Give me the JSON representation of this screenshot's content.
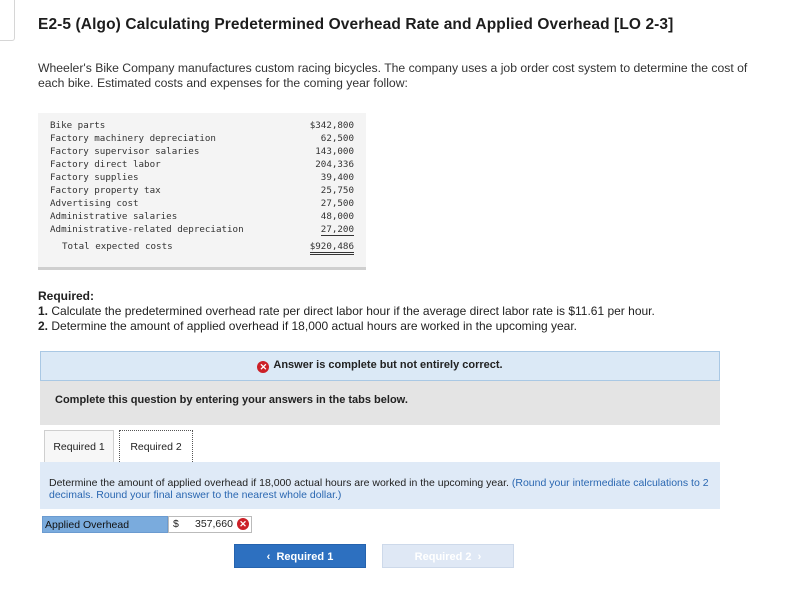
{
  "title": "E2-5 (Algo) Calculating Predetermined Overhead Rate and Applied Overhead [LO 2-3]",
  "intro": "Wheeler's Bike Company manufactures custom racing bicycles. The company uses a job order cost system to determine the cost of each bike. Estimated costs and expenses for the coming year follow:",
  "costs": [
    {
      "label": "Bike parts",
      "amount": "$342,800"
    },
    {
      "label": "Factory machinery depreciation",
      "amount": "62,500"
    },
    {
      "label": "Factory supervisor salaries",
      "amount": "143,000"
    },
    {
      "label": "Factory direct labor",
      "amount": "204,336"
    },
    {
      "label": "Factory supplies",
      "amount": "39,400"
    },
    {
      "label": "Factory property tax",
      "amount": "25,750"
    },
    {
      "label": "Advertising cost",
      "amount": "27,500"
    },
    {
      "label": "Administrative salaries",
      "amount": "48,000"
    },
    {
      "label": "Administrative-related depreciation",
      "amount": "27,200"
    }
  ],
  "total": {
    "label": "Total expected costs",
    "amount": "$920,486"
  },
  "required": {
    "heading": "Required:",
    "item1_num": "1.",
    "item1": "Calculate the predetermined overhead rate per direct labor hour if the average direct labor rate is $11.61 per hour.",
    "item2_num": "2.",
    "item2": "Determine the amount of applied overhead if 18,000 actual hours are worked in the upcoming year."
  },
  "banner": {
    "text": "Answer is complete but not entirely correct.",
    "icon": "x-circle-icon",
    "color": "#cc2027"
  },
  "instruction_box": {
    "text": "Complete this question by entering your answers in the tabs below."
  },
  "tabs": [
    {
      "label": "Required 1"
    },
    {
      "label": "Required 2"
    }
  ],
  "question": {
    "text": "Determine the amount of applied overhead if 18,000 actual hours are worked in the upcoming year.",
    "note": "(Round your intermediate calculations to 2 decimals. Round your final answer to the nearest whole dollar.)"
  },
  "answer": {
    "label": "Applied Overhead",
    "currency": "$",
    "value": "357,660",
    "status_icon": "x-circle-icon"
  },
  "nav": {
    "prev_label": "Required 1",
    "next_label": "Required 2"
  },
  "colors": {
    "accent": "#2d70c0",
    "error": "#cc2027",
    "banner_bg": "#dbe9f6",
    "label_bg": "#7aabdd"
  }
}
